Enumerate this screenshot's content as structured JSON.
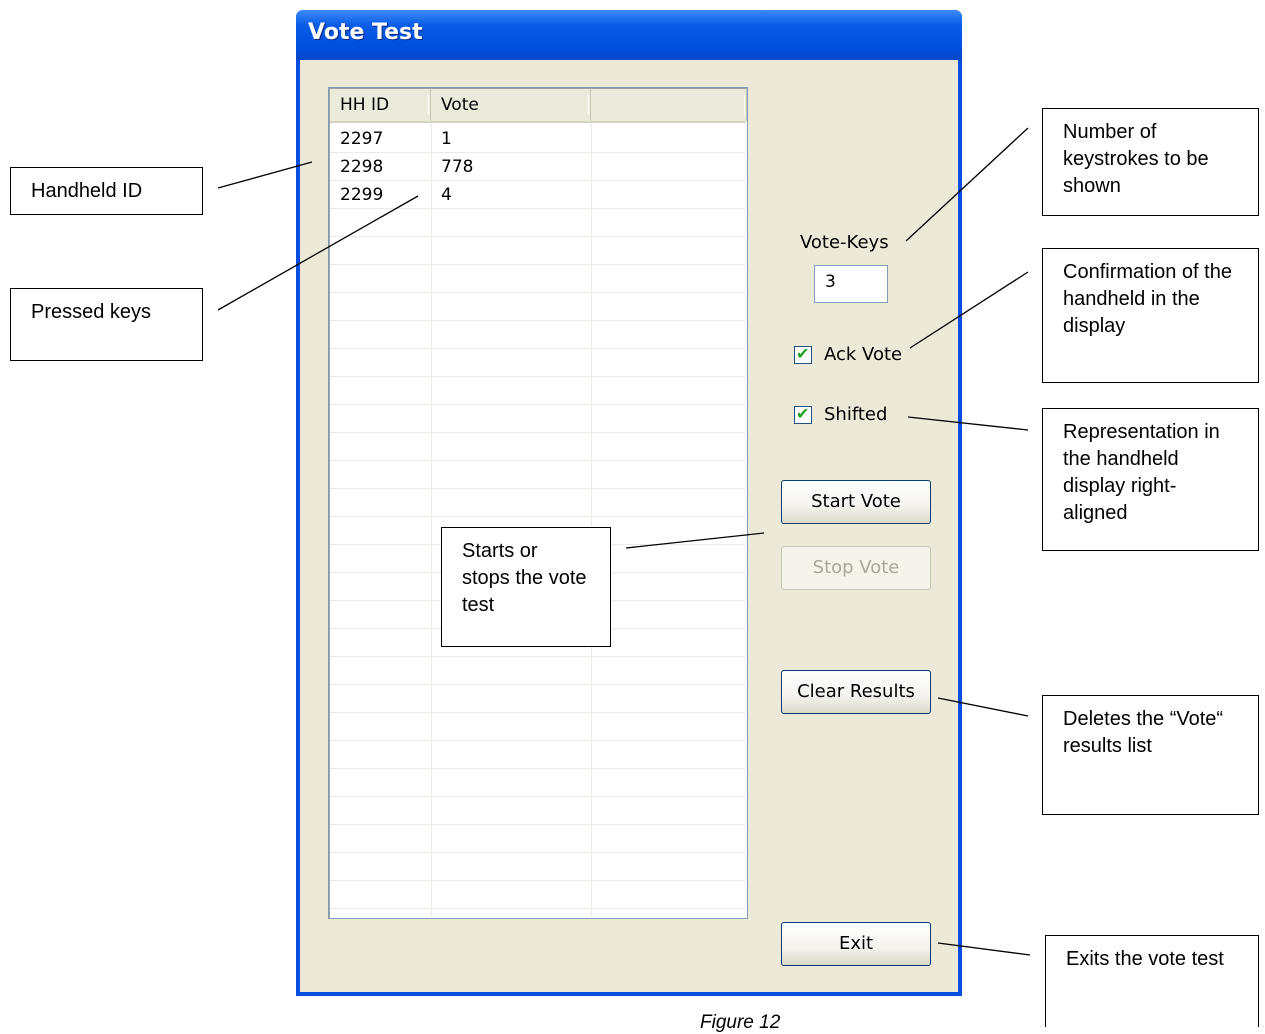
{
  "window": {
    "title": "Vote Test"
  },
  "list": {
    "columns": [
      "HH ID",
      "Vote",
      ""
    ],
    "rows": [
      {
        "hh_id": "2297",
        "vote": "1"
      },
      {
        "hh_id": "2298",
        "vote": "778"
      },
      {
        "hh_id": "2299",
        "vote": "4"
      }
    ]
  },
  "controls": {
    "vote_keys_label": "Vote-Keys",
    "vote_keys_value": "3",
    "ack_vote_label": "Ack Vote",
    "ack_vote_checked": true,
    "shifted_label": "Shifted",
    "shifted_checked": true,
    "start_vote": "Start Vote",
    "stop_vote": "Stop Vote",
    "clear_results": "Clear Results",
    "exit": "Exit"
  },
  "callouts": {
    "handheld_id": "Handheld ID",
    "pressed_keys": "Pressed keys",
    "keystrokes": "Number of keystrokes to be shown",
    "confirmation": "Confirmation of the handheld in the display",
    "representation": "Representation in the handheld display right-aligned",
    "starts_stops": "Starts or stops the vote test",
    "deletes": "Deletes the “Vote“ results list",
    "exits": "Exits the vote test"
  },
  "caption": "Figure 12"
}
